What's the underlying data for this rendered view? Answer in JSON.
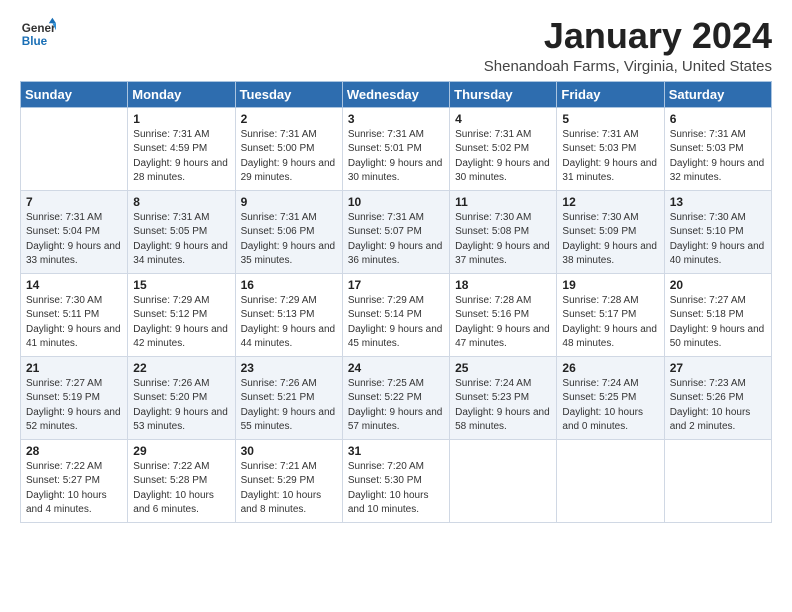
{
  "logo": {
    "line1": "General",
    "line2": "Blue"
  },
  "title": "January 2024",
  "location": "Shenandoah Farms, Virginia, United States",
  "weekdays": [
    "Sunday",
    "Monday",
    "Tuesday",
    "Wednesday",
    "Thursday",
    "Friday",
    "Saturday"
  ],
  "weeks": [
    [
      {
        "day": "",
        "sunrise": "",
        "sunset": "",
        "daylight": ""
      },
      {
        "day": "1",
        "sunrise": "Sunrise: 7:31 AM",
        "sunset": "Sunset: 4:59 PM",
        "daylight": "Daylight: 9 hours and 28 minutes."
      },
      {
        "day": "2",
        "sunrise": "Sunrise: 7:31 AM",
        "sunset": "Sunset: 5:00 PM",
        "daylight": "Daylight: 9 hours and 29 minutes."
      },
      {
        "day": "3",
        "sunrise": "Sunrise: 7:31 AM",
        "sunset": "Sunset: 5:01 PM",
        "daylight": "Daylight: 9 hours and 30 minutes."
      },
      {
        "day": "4",
        "sunrise": "Sunrise: 7:31 AM",
        "sunset": "Sunset: 5:02 PM",
        "daylight": "Daylight: 9 hours and 30 minutes."
      },
      {
        "day": "5",
        "sunrise": "Sunrise: 7:31 AM",
        "sunset": "Sunset: 5:03 PM",
        "daylight": "Daylight: 9 hours and 31 minutes."
      },
      {
        "day": "6",
        "sunrise": "Sunrise: 7:31 AM",
        "sunset": "Sunset: 5:03 PM",
        "daylight": "Daylight: 9 hours and 32 minutes."
      }
    ],
    [
      {
        "day": "7",
        "sunrise": "Sunrise: 7:31 AM",
        "sunset": "Sunset: 5:04 PM",
        "daylight": "Daylight: 9 hours and 33 minutes."
      },
      {
        "day": "8",
        "sunrise": "Sunrise: 7:31 AM",
        "sunset": "Sunset: 5:05 PM",
        "daylight": "Daylight: 9 hours and 34 minutes."
      },
      {
        "day": "9",
        "sunrise": "Sunrise: 7:31 AM",
        "sunset": "Sunset: 5:06 PM",
        "daylight": "Daylight: 9 hours and 35 minutes."
      },
      {
        "day": "10",
        "sunrise": "Sunrise: 7:31 AM",
        "sunset": "Sunset: 5:07 PM",
        "daylight": "Daylight: 9 hours and 36 minutes."
      },
      {
        "day": "11",
        "sunrise": "Sunrise: 7:30 AM",
        "sunset": "Sunset: 5:08 PM",
        "daylight": "Daylight: 9 hours and 37 minutes."
      },
      {
        "day": "12",
        "sunrise": "Sunrise: 7:30 AM",
        "sunset": "Sunset: 5:09 PM",
        "daylight": "Daylight: 9 hours and 38 minutes."
      },
      {
        "day": "13",
        "sunrise": "Sunrise: 7:30 AM",
        "sunset": "Sunset: 5:10 PM",
        "daylight": "Daylight: 9 hours and 40 minutes."
      }
    ],
    [
      {
        "day": "14",
        "sunrise": "Sunrise: 7:30 AM",
        "sunset": "Sunset: 5:11 PM",
        "daylight": "Daylight: 9 hours and 41 minutes."
      },
      {
        "day": "15",
        "sunrise": "Sunrise: 7:29 AM",
        "sunset": "Sunset: 5:12 PM",
        "daylight": "Daylight: 9 hours and 42 minutes."
      },
      {
        "day": "16",
        "sunrise": "Sunrise: 7:29 AM",
        "sunset": "Sunset: 5:13 PM",
        "daylight": "Daylight: 9 hours and 44 minutes."
      },
      {
        "day": "17",
        "sunrise": "Sunrise: 7:29 AM",
        "sunset": "Sunset: 5:14 PM",
        "daylight": "Daylight: 9 hours and 45 minutes."
      },
      {
        "day": "18",
        "sunrise": "Sunrise: 7:28 AM",
        "sunset": "Sunset: 5:16 PM",
        "daylight": "Daylight: 9 hours and 47 minutes."
      },
      {
        "day": "19",
        "sunrise": "Sunrise: 7:28 AM",
        "sunset": "Sunset: 5:17 PM",
        "daylight": "Daylight: 9 hours and 48 minutes."
      },
      {
        "day": "20",
        "sunrise": "Sunrise: 7:27 AM",
        "sunset": "Sunset: 5:18 PM",
        "daylight": "Daylight: 9 hours and 50 minutes."
      }
    ],
    [
      {
        "day": "21",
        "sunrise": "Sunrise: 7:27 AM",
        "sunset": "Sunset: 5:19 PM",
        "daylight": "Daylight: 9 hours and 52 minutes."
      },
      {
        "day": "22",
        "sunrise": "Sunrise: 7:26 AM",
        "sunset": "Sunset: 5:20 PM",
        "daylight": "Daylight: 9 hours and 53 minutes."
      },
      {
        "day": "23",
        "sunrise": "Sunrise: 7:26 AM",
        "sunset": "Sunset: 5:21 PM",
        "daylight": "Daylight: 9 hours and 55 minutes."
      },
      {
        "day": "24",
        "sunrise": "Sunrise: 7:25 AM",
        "sunset": "Sunset: 5:22 PM",
        "daylight": "Daylight: 9 hours and 57 minutes."
      },
      {
        "day": "25",
        "sunrise": "Sunrise: 7:24 AM",
        "sunset": "Sunset: 5:23 PM",
        "daylight": "Daylight: 9 hours and 58 minutes."
      },
      {
        "day": "26",
        "sunrise": "Sunrise: 7:24 AM",
        "sunset": "Sunset: 5:25 PM",
        "daylight": "Daylight: 10 hours and 0 minutes."
      },
      {
        "day": "27",
        "sunrise": "Sunrise: 7:23 AM",
        "sunset": "Sunset: 5:26 PM",
        "daylight": "Daylight: 10 hours and 2 minutes."
      }
    ],
    [
      {
        "day": "28",
        "sunrise": "Sunrise: 7:22 AM",
        "sunset": "Sunset: 5:27 PM",
        "daylight": "Daylight: 10 hours and 4 minutes."
      },
      {
        "day": "29",
        "sunrise": "Sunrise: 7:22 AM",
        "sunset": "Sunset: 5:28 PM",
        "daylight": "Daylight: 10 hours and 6 minutes."
      },
      {
        "day": "30",
        "sunrise": "Sunrise: 7:21 AM",
        "sunset": "Sunset: 5:29 PM",
        "daylight": "Daylight: 10 hours and 8 minutes."
      },
      {
        "day": "31",
        "sunrise": "Sunrise: 7:20 AM",
        "sunset": "Sunset: 5:30 PM",
        "daylight": "Daylight: 10 hours and 10 minutes."
      },
      {
        "day": "",
        "sunrise": "",
        "sunset": "",
        "daylight": ""
      },
      {
        "day": "",
        "sunrise": "",
        "sunset": "",
        "daylight": ""
      },
      {
        "day": "",
        "sunrise": "",
        "sunset": "",
        "daylight": ""
      }
    ]
  ]
}
